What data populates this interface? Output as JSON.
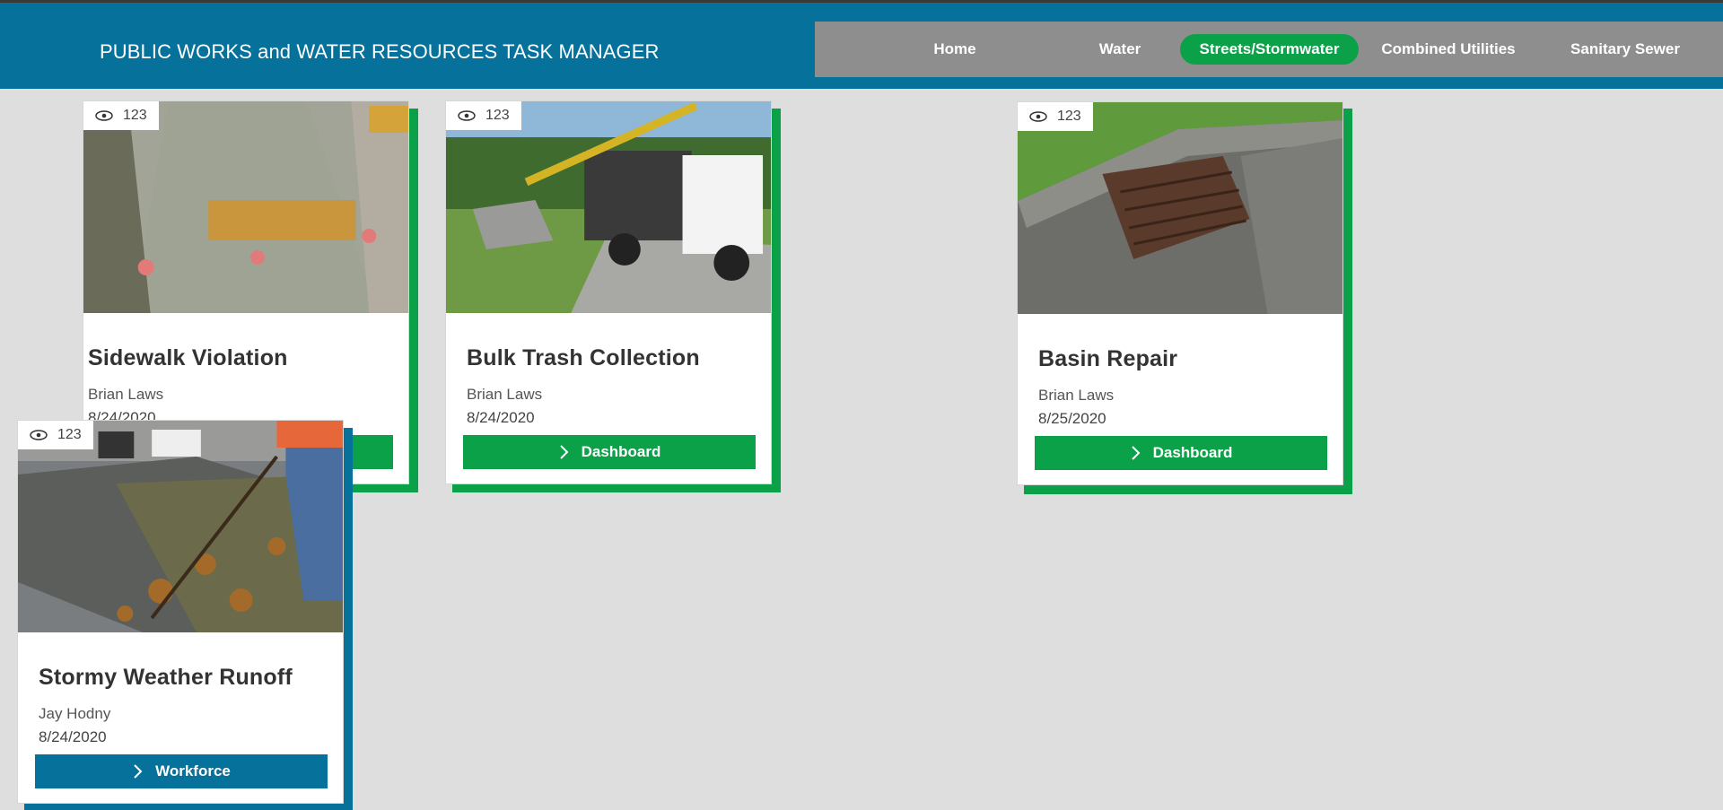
{
  "app": {
    "title": "PUBLIC WORKS and WATER RESOURCES TASK MANAGER"
  },
  "nav": {
    "items": [
      {
        "label": "Home"
      },
      {
        "label": "Water"
      },
      {
        "label": "Streets/Stormwater",
        "active": true
      },
      {
        "label": "Combined Utilities"
      },
      {
        "label": "Sanitary Sewer"
      }
    ]
  },
  "colors": {
    "header": "#06719b",
    "accent_green": "#0aa148",
    "background": "#dedede",
    "nav_bar": "#8e8e8e"
  },
  "cards": [
    {
      "title": "Sidewalk Violation",
      "author": "Brian Laws",
      "date": "8/24/2020",
      "views": "123",
      "button": "",
      "photo": "concrete-sidewalk-photo"
    },
    {
      "title": "Bulk Trash Collection",
      "author": "Brian Laws",
      "date": "8/24/2020",
      "views": "123",
      "button": "Dashboard",
      "photo": "trash-truck-photo"
    },
    {
      "title": "Basin Repair",
      "author": "Brian Laws",
      "date": "8/25/2020",
      "views": "123",
      "button": "Dashboard",
      "photo": "storm-drain-photo"
    },
    {
      "title": "Stormy Weather Runoff",
      "author": "Jay Hodny",
      "date": "8/24/2020",
      "views": "123",
      "button": "Workforce",
      "photo": "raking-leaves-photo"
    }
  ]
}
